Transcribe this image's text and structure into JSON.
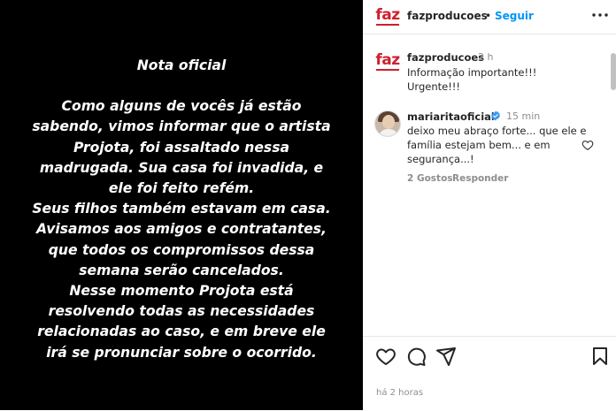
{
  "story": {
    "lines": [
      "Nota oficial",
      "",
      "Como alguns de vocês já estão",
      "sabendo, vimos informar que o artista",
      "Projota, foi assaltado nessa",
      "madrugada. Sua casa foi invadida, e",
      "ele foi feito refém.",
      "Seus filhos também estavam em casa.",
      "Avisamos aos amigos e contratantes,",
      "que todos os compromissos dessa",
      "semana serão cancelados.",
      "Nesse momento Projota está",
      "resolvendo todas as necessidades",
      "relacionadas ao caso, e em breve ele",
      "irá se pronunciar sobre o ocorrido."
    ]
  },
  "header": {
    "logo_text": "faz",
    "username": "fazproducoes",
    "separator": "•",
    "follow_label": "Seguir",
    "more_icon": "more-horizontal-icon"
  },
  "caption": {
    "username": "fazproducoes",
    "time": "2 h",
    "lines": [
      "Informação importante!!!",
      "Urgente!!!"
    ]
  },
  "comment": {
    "username": "mariaritaoficial",
    "time": "15 min",
    "lines": [
      "deixo meu abraço forte... que ele e",
      "família estejam bem... e em",
      "segurança...!"
    ],
    "likes": "2 Gostos",
    "reply": "Responder"
  },
  "footer": {
    "timestamp": "há 2 horas"
  },
  "colors": {
    "brand_red": "#cf1f2e",
    "follow_blue": "#0095f6",
    "verified_blue": "#3897f0",
    "muted": "#8e8e8e"
  }
}
